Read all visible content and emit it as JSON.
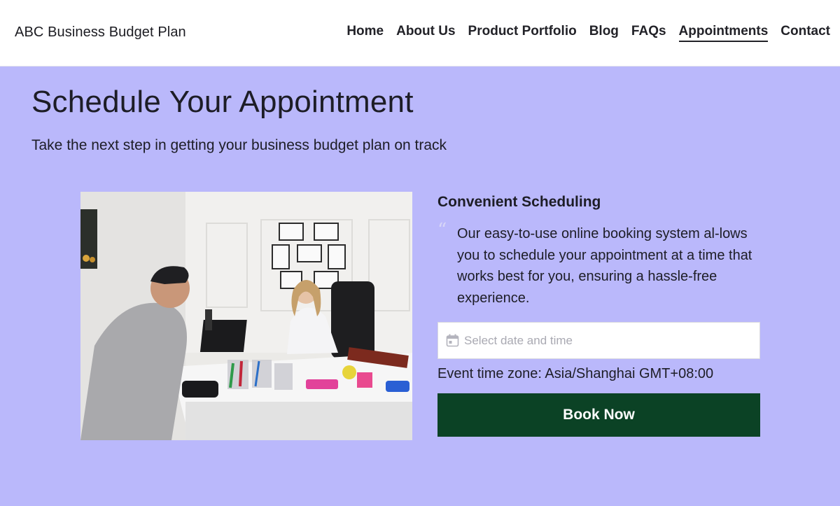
{
  "header": {
    "brand": "ABC Business Budget Plan",
    "nav": [
      {
        "label": "Home"
      },
      {
        "label": "About Us"
      },
      {
        "label": "Product Portfolio"
      },
      {
        "label": "Blog"
      },
      {
        "label": "FAQs"
      },
      {
        "label": "Appointments",
        "active": true
      },
      {
        "label": "Contact"
      }
    ]
  },
  "hero": {
    "title": "Schedule Your Appointment",
    "subtitle": "Take the next step in getting your business budget plan on track",
    "background_color": "#bab8fb"
  },
  "photo": {
    "alt_icon": "office-consultation-photo"
  },
  "scheduling": {
    "heading": "Convenient Scheduling",
    "quote": "Our easy-to-use online booking system al-lows you to schedule your appointment at a time that works best for you, ensuring a hassle-free experience.",
    "date_input": {
      "placeholder": "Select date and time",
      "value": "",
      "icon": "calendar-icon"
    },
    "timezone": "Event time zone: Asia/Shanghai GMT+08:00",
    "book_button": "Book Now",
    "button_color": "#0b4225"
  }
}
